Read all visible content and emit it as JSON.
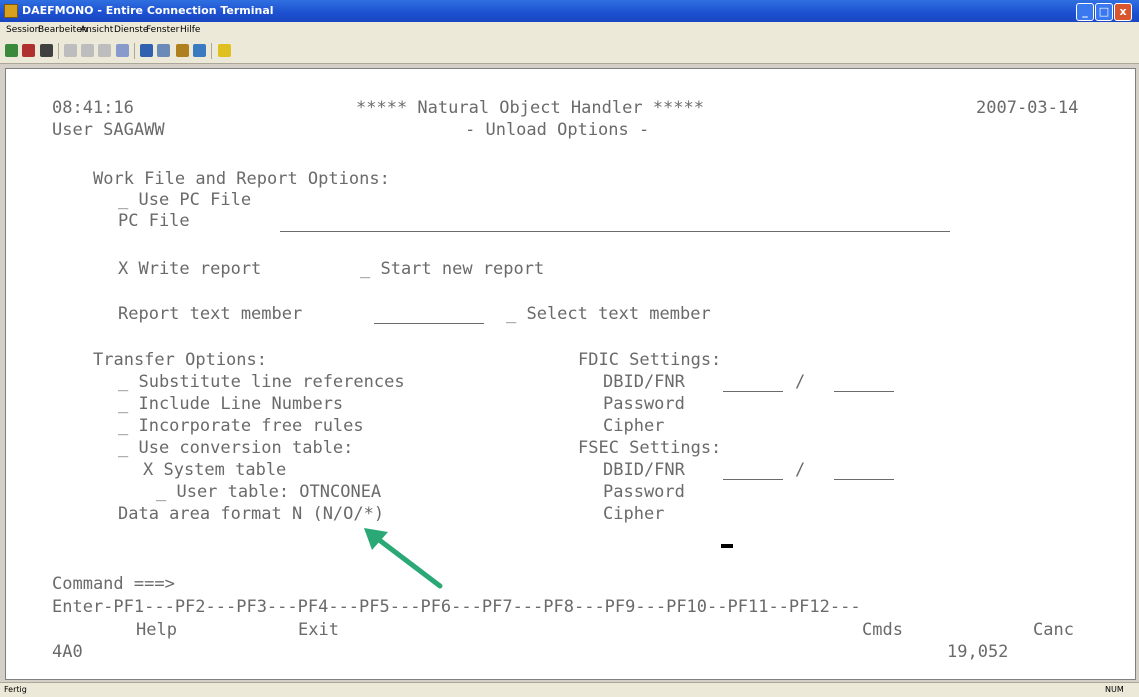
{
  "window": {
    "title": "DAEFMONO - Entire Connection Terminal",
    "minimize": "_",
    "maximize": "□",
    "close": "x"
  },
  "menu": [
    "Session",
    "Bearbeiten",
    "Ansicht",
    "Dienste",
    "Fenster",
    "Hilfe"
  ],
  "toolbar_icons": [
    "connect-icon",
    "disconnect-icon",
    "print-icon",
    "cut-icon",
    "copy-icon",
    "paste-icon",
    "transfer-icon",
    "settings-icon",
    "keyboard-icon",
    "macro-icon",
    "check-icon",
    "help-icon"
  ],
  "terminal": {
    "time": "08:41:16",
    "title": "***** Natural Object Handler *****",
    "date": "2007-03-14",
    "user": "User SAGAWW",
    "subtitle": "- Unload Options -",
    "work_file_heading": "Work File and Report Options:",
    "use_pc_file": "_ Use PC File",
    "pc_file_label": "PC File",
    "write_report": "X Write report",
    "start_new_report": "_ Start new report",
    "report_text_member_label": "Report text member",
    "select_text_member": "_ Select text member",
    "transfer_heading": "Transfer Options:",
    "transfer_options": [
      "_ Substitute line references",
      "_ Include Line Numbers",
      "_ Incorporate free rules",
      "_ Use conversion table:"
    ],
    "system_table": "X System table",
    "user_table": "_ User table: OTNCONEA",
    "data_area_format": "Data area format N (N/O/*)",
    "fdic_heading": "FDIC Settings:",
    "fdic_dbid": "DBID/FNR",
    "fdic_password": "Password",
    "fdic_cipher": "Cipher",
    "fsec_heading": "FSEC Settings:",
    "fsec_dbid": "DBID/FNR",
    "fsec_password": "Password",
    "fsec_cipher": "Cipher",
    "slash": "/",
    "command_label": "Command ===>",
    "pf_line": "Enter-PF1---PF2---PF3---PF4---PF5---PF6---PF7---PF8---PF9---PF10--PF11--PF12---",
    "pf_help": "Help",
    "pf_exit": "Exit",
    "pf_cmds": "Cmds",
    "pf_canc": "Canc",
    "session_id": "4A0",
    "position": "19,052"
  },
  "annotation": {
    "color": "#2aa876",
    "icon": "arrow-icon"
  },
  "status": {
    "left": "Fertig",
    "right": "NUM"
  }
}
